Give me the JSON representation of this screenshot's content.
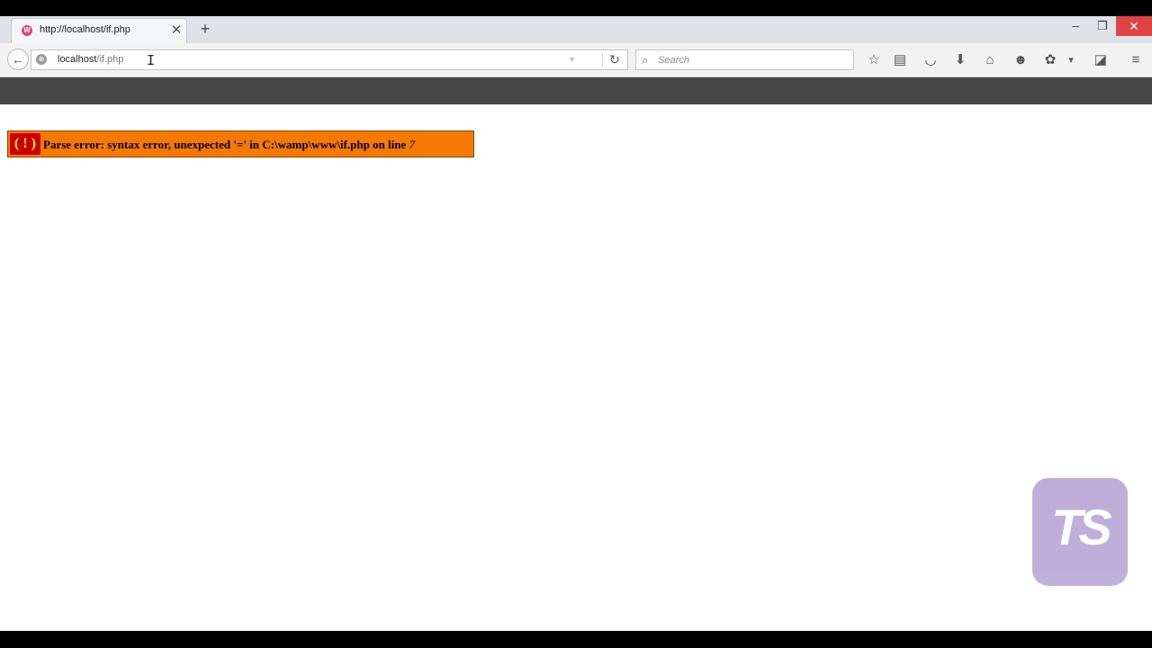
{
  "tab": {
    "title": "http://localhost/if.php",
    "close_glyph": "✕",
    "new_tab_glyph": "+"
  },
  "window_controls": {
    "minimize": "–",
    "restore": "❐",
    "close": "✕"
  },
  "nav": {
    "back_glyph": "←",
    "url_host": "localhost",
    "url_path": "/if.php",
    "reload_glyph": "↻",
    "dropdown_glyph": "▼"
  },
  "search": {
    "placeholder": "Search",
    "icon_glyph": "⌕"
  },
  "toolbar": {
    "icons": [
      {
        "name": "bookmark-star-icon",
        "glyph": "☆"
      },
      {
        "name": "reading-list-icon",
        "glyph": "▤"
      },
      {
        "name": "pocket-icon",
        "glyph": "◡"
      },
      {
        "name": "download-icon",
        "glyph": "⬇"
      },
      {
        "name": "home-icon",
        "glyph": "⌂"
      },
      {
        "name": "chat-icon",
        "glyph": "☻"
      },
      {
        "name": "addon-icon",
        "glyph": "✿"
      },
      {
        "name": "dropdown-caret-icon",
        "glyph": "▾"
      },
      {
        "name": "extension-icon",
        "glyph": "◪"
      },
      {
        "name": "menu-icon",
        "glyph": "≡"
      }
    ]
  },
  "error": {
    "icon_text": "( ! )",
    "message": "Parse error: syntax error, unexpected '=' in C:\\wamp\\www\\if.php on line ",
    "line_number": "7"
  },
  "watermark": {
    "text": "TS"
  },
  "colors": {
    "error_bg": "#f57900",
    "error_icon_bg": "#cc0000",
    "watermark_bg": "#b9a6d6"
  }
}
